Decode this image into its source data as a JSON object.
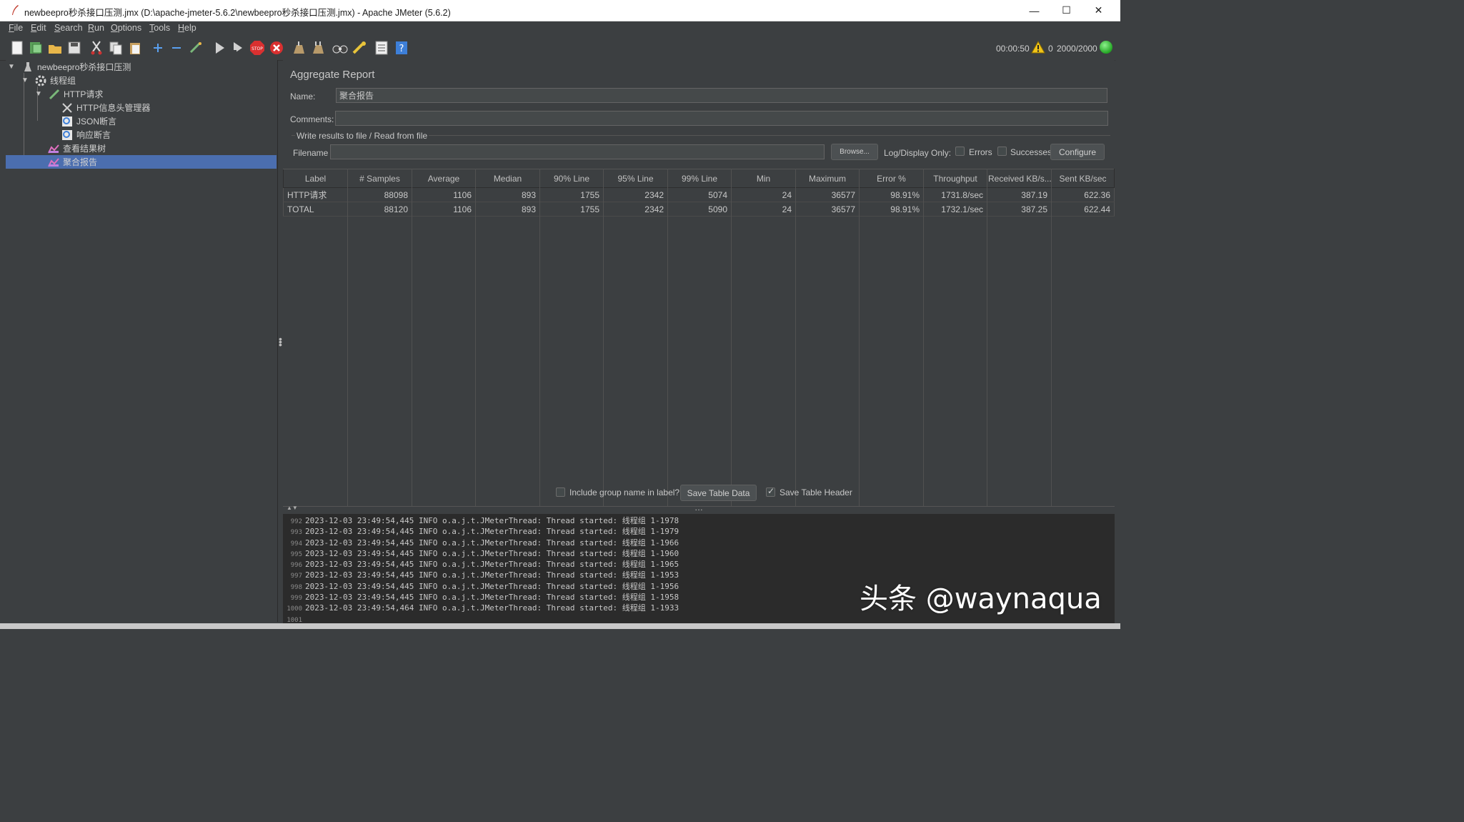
{
  "window": {
    "title": "newbeepro秒杀接口压测.jmx (D:\\apache-jmeter-5.6.2\\newbeepro秒杀接口压测.jmx) - Apache JMeter (5.6.2)",
    "minimize": "—",
    "maximize": "☐",
    "close": "✕"
  },
  "menu": [
    {
      "key": "F",
      "rest": "ile"
    },
    {
      "key": "E",
      "rest": "dit"
    },
    {
      "key": "S",
      "rest": "earch"
    },
    {
      "key": "R",
      "rest": "un"
    },
    {
      "key": "O",
      "rest": "ptions"
    },
    {
      "key": "T",
      "rest": "ools"
    },
    {
      "key": "H",
      "rest": "elp"
    }
  ],
  "toolbar": {
    "icons": [
      "new-icon",
      "templates-icon",
      "open-icon",
      "save-icon",
      "cut-icon",
      "copy-icon",
      "paste-icon",
      "expand-icon",
      "collapse-icon",
      "toggle-icon",
      "start-icon",
      "start-no-pause-icon",
      "stop-icon",
      "shutdown-icon",
      "clear-icon",
      "clear-all-icon",
      "search-icon",
      "reset-search-icon",
      "function-helper-icon",
      "help-icon"
    ]
  },
  "status": {
    "elapsed": "00:00:50",
    "warnings": "0",
    "threads": "2000/2000"
  },
  "tree": [
    {
      "label": "newbeepro秒杀接口压测",
      "icon": "test-plan-icon",
      "level": 0
    },
    {
      "label": "线程组",
      "icon": "thread-group-icon",
      "level": 1
    },
    {
      "label": "HTTP请求",
      "icon": "http-sampler-icon",
      "level": 2
    },
    {
      "label": "HTTP信息头管理器",
      "icon": "header-manager-icon",
      "level": 3
    },
    {
      "label": "JSON断言",
      "icon": "json-assertion-icon",
      "level": 3
    },
    {
      "label": "响应断言",
      "icon": "response-assertion-icon",
      "level": 3
    },
    {
      "label": "查看结果树",
      "icon": "results-tree-icon",
      "level": 2
    },
    {
      "label": "聚合报告",
      "icon": "aggregate-report-icon",
      "level": 2,
      "selected": true
    }
  ],
  "panel": {
    "title": "Aggregate Report",
    "name_label": "Name:",
    "name_value": "聚合报告",
    "comments_label": "Comments:",
    "comments_value": "",
    "file_group": "Write results to file / Read from file",
    "filename_label": "Filename",
    "filename_value": "",
    "browse": "Browse...",
    "log_display_only": "Log/Display Only:",
    "errors": "Errors",
    "successes": "Successes",
    "configure": "Configure"
  },
  "table": {
    "headers": [
      "Label",
      "# Samples",
      "Average",
      "Median",
      "90% Line",
      "95% Line",
      "99% Line",
      "Min",
      "Maximum",
      "Error %",
      "Throughput",
      "Received KB/s...",
      "Sent KB/sec"
    ],
    "rows": [
      [
        "HTTP请求",
        "88098",
        "1106",
        "893",
        "1755",
        "2342",
        "5074",
        "24",
        "36577",
        "98.91%",
        "1731.8/sec",
        "387.19",
        "622.36"
      ],
      [
        "TOTAL",
        "88120",
        "1106",
        "893",
        "1755",
        "2342",
        "5090",
        "24",
        "36577",
        "98.91%",
        "1732.1/sec",
        "387.25",
        "622.44"
      ]
    ]
  },
  "bottom": {
    "include_group": "Include group name in label?",
    "save_table_data": "Save Table Data",
    "save_table_header": "Save Table Header"
  },
  "log": [
    {
      "n": "992",
      "text": "2023-12-03 23:49:54,445 INFO o.a.j.t.JMeterThread: Thread started: 线程组 1-1978"
    },
    {
      "n": "993",
      "text": "2023-12-03 23:49:54,445 INFO o.a.j.t.JMeterThread: Thread started: 线程组 1-1979"
    },
    {
      "n": "994",
      "text": "2023-12-03 23:49:54,445 INFO o.a.j.t.JMeterThread: Thread started: 线程组 1-1966"
    },
    {
      "n": "995",
      "text": "2023-12-03 23:49:54,445 INFO o.a.j.t.JMeterThread: Thread started: 线程组 1-1960"
    },
    {
      "n": "996",
      "text": "2023-12-03 23:49:54,445 INFO o.a.j.t.JMeterThread: Thread started: 线程组 1-1965"
    },
    {
      "n": "997",
      "text": "2023-12-03 23:49:54,445 INFO o.a.j.t.JMeterThread: Thread started: 线程组 1-1953"
    },
    {
      "n": "998",
      "text": "2023-12-03 23:49:54,445 INFO o.a.j.t.JMeterThread: Thread started: 线程组 1-1956"
    },
    {
      "n": "999",
      "text": "2023-12-03 23:49:54,445 INFO o.a.j.t.JMeterThread: Thread started: 线程组 1-1958"
    },
    {
      "n": "1000",
      "text": "2023-12-03 23:49:54,464 INFO o.a.j.t.JMeterThread: Thread started: 线程组 1-1933"
    },
    {
      "n": "1001",
      "text": ""
    }
  ],
  "watermark": "头条 @waynaqua"
}
